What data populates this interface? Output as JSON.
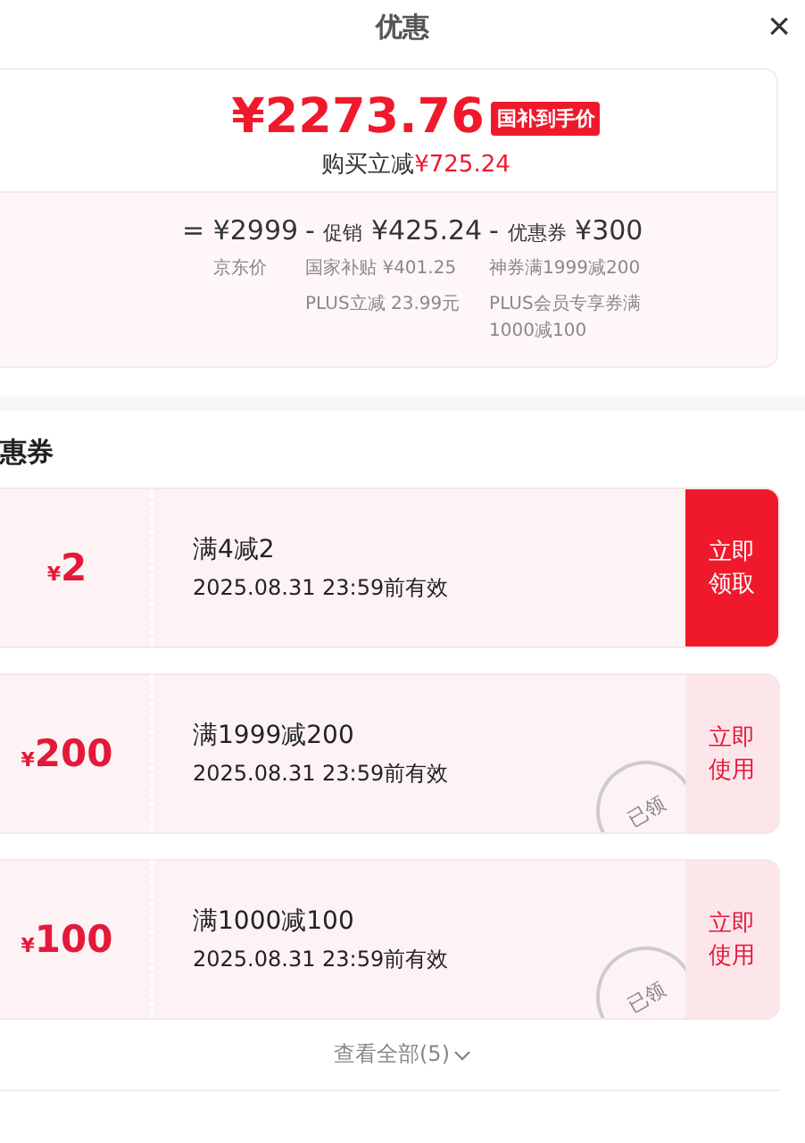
{
  "header": {
    "title": "优惠",
    "close": "×"
  },
  "summary": {
    "final_price": "¥2273.76",
    "badge": "国补到手价",
    "saving_label": "购买立减",
    "saving_value": "¥725.24",
    "breakdown": [
      {
        "op": "=",
        "amount": "¥2999",
        "notes": [
          "京东价"
        ]
      },
      {
        "op": "-",
        "label": "促销",
        "amount": "¥425.24",
        "notes": [
          "国家补贴 ¥401.25",
          "PLUS立减 23.99元"
        ]
      },
      {
        "op": "-",
        "label": "优惠券",
        "amount": "¥300",
        "notes": [
          "神券满1999减200",
          "PLUS会员专享券满1000减100"
        ]
      }
    ]
  },
  "coupons_title": "惠券",
  "coupons": [
    {
      "amount": "2",
      "condition": "满4减2",
      "validity": "2025.08.31 23:59前有效",
      "action": "立即领取",
      "claimed": false
    },
    {
      "amount": "200",
      "condition": "满1999减200",
      "validity": "2025.08.31 23:59前有效",
      "action": "立即使用",
      "claimed": true,
      "stamp": "已领"
    },
    {
      "amount": "100",
      "condition": "满1000减100",
      "validity": "2025.08.31 23:59前有效",
      "action": "立即使用",
      "claimed": true,
      "stamp": "已领"
    }
  ],
  "currency": "¥",
  "view_all": "查看全部(5)"
}
